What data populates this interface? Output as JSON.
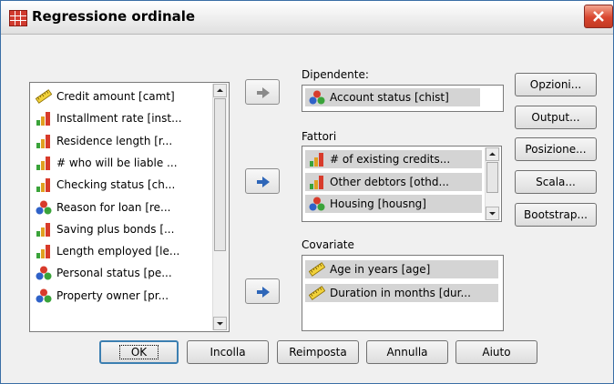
{
  "window": {
    "title": "Regressione ordinale"
  },
  "variables": [
    {
      "label": "Credit amount [camt]",
      "icon": "scale-ruler-icon"
    },
    {
      "label": "Installment rate [inst...",
      "icon": "ordinal-bars-icon"
    },
    {
      "label": "Residence length [r...",
      "icon": "ordinal-bars-icon"
    },
    {
      "label": "# who will be liable ...",
      "icon": "ordinal-bars-icon"
    },
    {
      "label": "Checking status [ch...",
      "icon": "ordinal-bars-icon"
    },
    {
      "label": "Reason for loan [re...",
      "icon": "nominal-balls-icon"
    },
    {
      "label": "Saving plus bonds [...",
      "icon": "ordinal-bars-icon"
    },
    {
      "label": "Length employed [le...",
      "icon": "ordinal-bars-icon"
    },
    {
      "label": "Personal status [pe...",
      "icon": "nominal-balls-icon"
    },
    {
      "label": "Property owner [pr...",
      "icon": "nominal-balls-icon"
    }
  ],
  "dependent": {
    "label": "Dipendente:",
    "value": {
      "label": "Account status [chist]",
      "icon": "nominal-balls-icon"
    }
  },
  "factors": {
    "label": "Fattori",
    "items": [
      {
        "label": "# of existing credits...",
        "icon": "ordinal-bars-icon"
      },
      {
        "label": "Other debtors [othd...",
        "icon": "ordinal-bars-icon"
      },
      {
        "label": "Housing [housng]",
        "icon": "nominal-balls-icon"
      }
    ]
  },
  "covariates": {
    "label": "Covariate",
    "items": [
      {
        "label": "Age in years [age]",
        "icon": "scale-ruler-icon"
      },
      {
        "label": "Duration in months [dur...",
        "icon": "scale-ruler-icon"
      }
    ]
  },
  "side_buttons": {
    "options": "Opzioni...",
    "output": "Output...",
    "location": "Posizione...",
    "scale": "Scala...",
    "bootstrap": "Bootstrap..."
  },
  "bottom_buttons": {
    "ok": "OK",
    "paste": "Incolla",
    "reset": "Reimposta",
    "cancel": "Annulla",
    "help": "Aiuto"
  },
  "colors": {
    "title_border": "#3a6ea5",
    "close_button": "#d9462f",
    "arrow_blue": "#2e66b8",
    "selection_gray": "#d4d4d4"
  }
}
